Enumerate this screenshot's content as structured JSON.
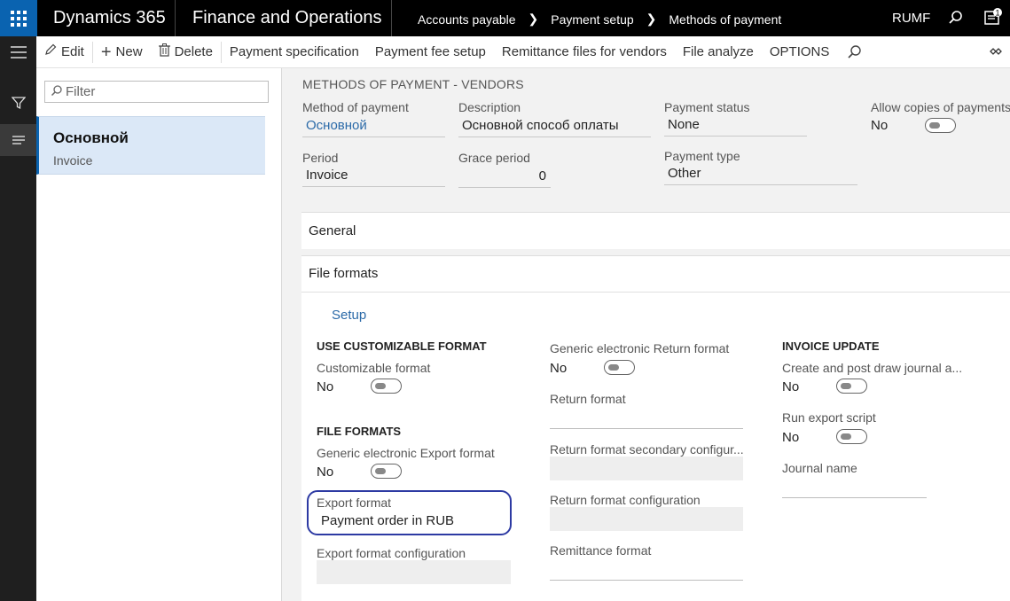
{
  "topbar": {
    "product": "Dynamics 365",
    "module": "Finance and Operations",
    "breadcrumb": [
      "Accounts payable",
      "Payment setup",
      "Methods of payment"
    ],
    "company": "RUMF",
    "message_count": "1"
  },
  "actions": {
    "edit": "Edit",
    "new": "New",
    "delete": "Delete",
    "payment_specification": "Payment specification",
    "payment_fee_setup": "Payment fee setup",
    "remittance_files": "Remittance files for vendors",
    "file_analyze": "File analyze",
    "options": "OPTIONS"
  },
  "list": {
    "filter_placeholder": "Filter",
    "items": [
      {
        "title": "Основной",
        "subtitle": "Invoice"
      }
    ]
  },
  "details": {
    "caption": "METHODS OF PAYMENT - VENDORS",
    "method_of_payment": {
      "label": "Method of payment",
      "value": "Основной"
    },
    "description": {
      "label": "Description",
      "value": "Основной способ оплаты"
    },
    "payment_status": {
      "label": "Payment status",
      "value": "None"
    },
    "allow_copies": {
      "label": "Allow copies of payments:",
      "value": "No"
    },
    "period": {
      "label": "Period",
      "value": "Invoice"
    },
    "grace_period": {
      "label": "Grace period",
      "value": "0"
    },
    "payment_type": {
      "label": "Payment type",
      "value": "Other"
    }
  },
  "tabs": {
    "general": "General",
    "file_formats": "File formats"
  },
  "file_formats": {
    "setup_link": "Setup",
    "use_customizable_header": "USE CUSTOMIZABLE FORMAT",
    "customizable_format": {
      "label": "Customizable format",
      "value": "No"
    },
    "file_formats_header": "FILE FORMATS",
    "generic_export": {
      "label": "Generic electronic Export format",
      "value": "No"
    },
    "export_format": {
      "label": "Export format",
      "value": "Payment order in RUB"
    },
    "export_format_configuration": {
      "label": "Export format configuration",
      "value": ""
    },
    "generic_return": {
      "label": "Generic electronic Return format",
      "value": "No"
    },
    "return_format": {
      "label": "Return format",
      "value": ""
    },
    "return_secondary": {
      "label": "Return format secondary configur...",
      "value": ""
    },
    "return_configuration": {
      "label": "Return format configuration",
      "value": ""
    },
    "remittance_format": {
      "label": "Remittance format",
      "value": ""
    },
    "invoice_update_header": "INVOICE UPDATE",
    "create_post_draw": {
      "label": "Create and post draw journal a...",
      "value": "No"
    },
    "run_export_script": {
      "label": "Run export script",
      "value": "No"
    },
    "journal_name": {
      "label": "Journal name",
      "value": ""
    }
  },
  "colors": {
    "accent": "#0a63b0",
    "link": "#2b6aa8",
    "highlight_outline": "#2d3aa3"
  }
}
